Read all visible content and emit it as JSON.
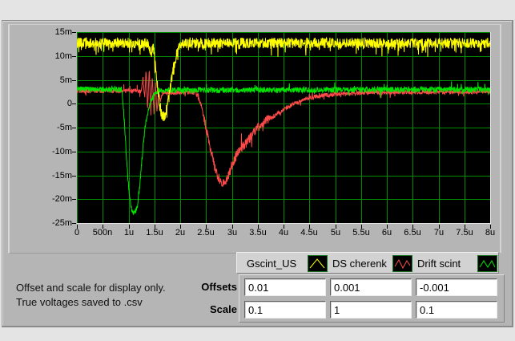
{
  "window": {
    "background": "#e4e4e4",
    "panel_color": "#b5b5b5"
  },
  "graph": {
    "plot_background": "#000000",
    "grid_color": "#008c00",
    "y_ticks": [
      "15m",
      "10m",
      "5m",
      "0",
      "-5m",
      "-10m",
      "-15m",
      "-20m",
      "-25m"
    ],
    "x_ticks": [
      "0",
      "500n",
      "1u",
      "1.5u",
      "2u",
      "2.5u",
      "3u",
      "3.5u",
      "4u",
      "4.5u",
      "5u",
      "5.5u",
      "6u",
      "6.5u",
      "7u",
      "7.5u",
      "8u"
    ]
  },
  "chart_data": {
    "type": "line",
    "x_axis": {
      "ticks": [
        "0",
        "500n",
        "1u",
        "1.5u",
        "2u",
        "2.5u",
        "3u",
        "3.5u",
        "4u",
        "4.5u",
        "5u",
        "5.5u",
        "6u",
        "6.5u",
        "7u",
        "7.5u",
        "8u"
      ],
      "range_us": [
        0,
        8
      ]
    },
    "y_axis": {
      "ticks": [
        "15m",
        "10m",
        "5m",
        "0",
        "-5m",
        "-10m",
        "-15m",
        "-20m",
        "-25m"
      ],
      "range_mV": [
        -25,
        15
      ]
    },
    "grid": "on",
    "legend_position": "below-right",
    "series": [
      {
        "name": "Gscint_US",
        "color": "#ffff00",
        "noise_mV": 1.1,
        "spike_prob": 0.1,
        "spike_mV": 2.0,
        "spike_dir": "down",
        "rough_below": null,
        "rough_factor": 1,
        "keypoints_us_mV": [
          [
            0,
            12.7
          ],
          [
            1.38,
            12.7
          ],
          [
            1.44,
            10.5
          ],
          [
            1.48,
            12
          ],
          [
            1.52,
            8
          ],
          [
            1.56,
            4
          ],
          [
            1.6,
            0
          ],
          [
            1.65,
            -2.3
          ],
          [
            1.7,
            -2.6
          ],
          [
            1.74,
            -1
          ],
          [
            1.8,
            3
          ],
          [
            1.86,
            7
          ],
          [
            1.93,
            10.5
          ],
          [
            2.02,
            12.7
          ],
          [
            8,
            12.7
          ]
        ]
      },
      {
        "name": "DS cherenk",
        "color": "#ff4a4a",
        "noise_mV": 0.45,
        "spike_prob": 0.04,
        "spike_mV": 1.1,
        "spike_dir": "both",
        "rough_below": -3,
        "rough_factor": 2.2,
        "keypoints_us_mV": [
          [
            0,
            2.7
          ],
          [
            1.25,
            2.7
          ],
          [
            1.28,
            5.5
          ],
          [
            1.31,
            1
          ],
          [
            1.34,
            7
          ],
          [
            1.37,
            -1
          ],
          [
            1.4,
            7.5
          ],
          [
            1.43,
            -2
          ],
          [
            1.46,
            6
          ],
          [
            1.49,
            -2.5
          ],
          [
            1.52,
            4
          ],
          [
            1.55,
            -1.5
          ],
          [
            1.58,
            2.5
          ],
          [
            1.62,
            0.5
          ],
          [
            1.66,
            2.3
          ],
          [
            2.3,
            2.4
          ],
          [
            2.4,
            0
          ],
          [
            2.5,
            -5
          ],
          [
            2.58,
            -9
          ],
          [
            2.66,
            -13
          ],
          [
            2.74,
            -15.5
          ],
          [
            2.8,
            -16.5
          ],
          [
            2.86,
            -16.8
          ],
          [
            2.92,
            -15.5
          ],
          [
            3.0,
            -13
          ],
          [
            3.1,
            -10.5
          ],
          [
            3.2,
            -9
          ],
          [
            3.3,
            -8
          ],
          [
            3.45,
            -5.5
          ],
          [
            3.6,
            -4
          ],
          [
            3.8,
            -2.7
          ],
          [
            4.1,
            -0.5
          ],
          [
            4.35,
            0.6
          ],
          [
            4.6,
            1.5
          ],
          [
            5.0,
            2.0
          ],
          [
            5.5,
            2.3
          ],
          [
            6.0,
            2.4
          ],
          [
            8,
            2.5
          ]
        ]
      },
      {
        "name": "Drift scint",
        "color": "#00e400",
        "noise_mV": 0.6,
        "spike_prob": 0.05,
        "spike_mV": 1.3,
        "spike_dir": "both",
        "rough_below": null,
        "rough_factor": 1,
        "keypoints_us_mV": [
          [
            0,
            3
          ],
          [
            0.87,
            3
          ],
          [
            0.92,
            -4
          ],
          [
            0.97,
            -13
          ],
          [
            1.02,
            -20
          ],
          [
            1.07,
            -22.5
          ],
          [
            1.12,
            -23
          ],
          [
            1.17,
            -21.5
          ],
          [
            1.22,
            -17
          ],
          [
            1.28,
            -9
          ],
          [
            1.33,
            -4
          ],
          [
            1.4,
            -0.5
          ],
          [
            1.48,
            1.5
          ],
          [
            1.58,
            2.8
          ],
          [
            8,
            3
          ]
        ]
      }
    ],
    "draw_order": [
      1,
      2,
      0
    ]
  },
  "legend": {
    "items": [
      {
        "label": "Gscint_US",
        "color": "#ffff00",
        "icon": "line-style-icon"
      },
      {
        "label": "DS cherenk",
        "color": "#ff4a4a",
        "icon": "line-style-icon"
      },
      {
        "label": "Drift scint",
        "color": "#00e400",
        "icon": "line-style-icon"
      }
    ]
  },
  "controls": {
    "offsets_label": "Offsets",
    "scale_label": "Scale",
    "offsets": [
      "0.01",
      "0.001",
      "-0.001"
    ],
    "scale": [
      "0.1",
      "1",
      "0.1"
    ]
  },
  "note": {
    "line1": "Offset and scale for display only.",
    "line2": "True voltages saved to .csv"
  }
}
